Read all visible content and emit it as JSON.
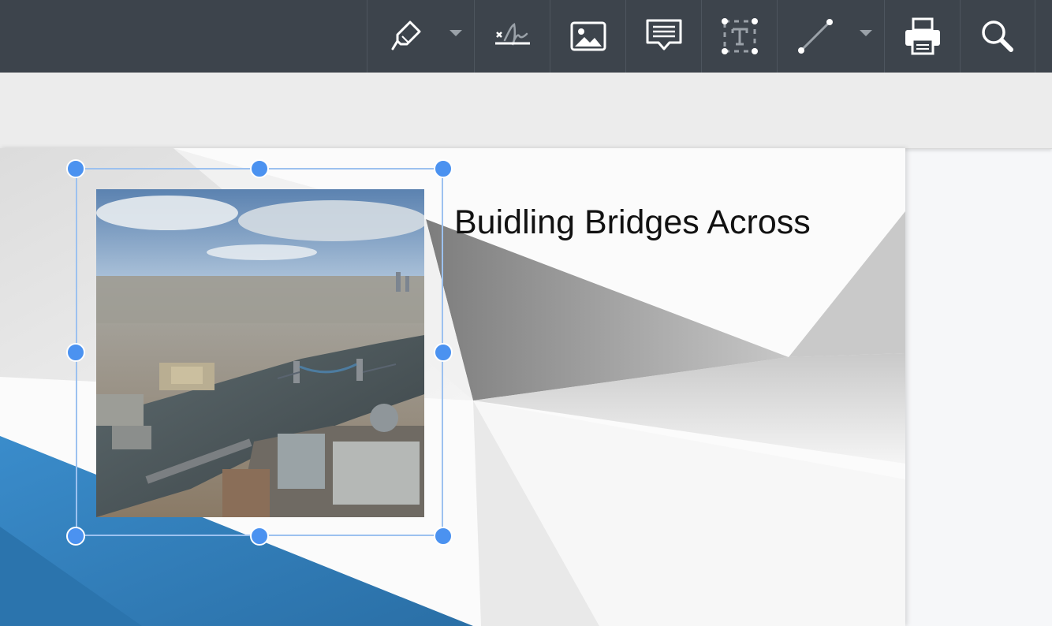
{
  "toolbar": {
    "tools": [
      {
        "name": "highlight-tool",
        "icon": "pen-icon",
        "has_dropdown": true
      },
      {
        "name": "signature-tool",
        "icon": "signature-icon",
        "has_dropdown": false
      },
      {
        "name": "image-tool",
        "icon": "image-icon",
        "has_dropdown": false
      },
      {
        "name": "comment-tool",
        "icon": "comment-icon",
        "has_dropdown": false
      },
      {
        "name": "text-box-tool",
        "icon": "text-box-icon",
        "has_dropdown": false
      },
      {
        "name": "line-tool",
        "icon": "line-icon",
        "has_dropdown": true
      },
      {
        "name": "print-tool",
        "icon": "printer-icon",
        "has_dropdown": false
      },
      {
        "name": "search-tool",
        "icon": "search-icon",
        "has_dropdown": false
      }
    ],
    "colors": {
      "background": "#3d444c",
      "icon": "#ffffff",
      "caret": "#9aa1a8"
    }
  },
  "document": {
    "heading": "Buidling Bridges Across",
    "selected_image": {
      "description_icon": "photo-icon",
      "selected": true
    },
    "colors": {
      "selection": "#4b92f0",
      "accent_blue": "#2f7bb8"
    }
  }
}
